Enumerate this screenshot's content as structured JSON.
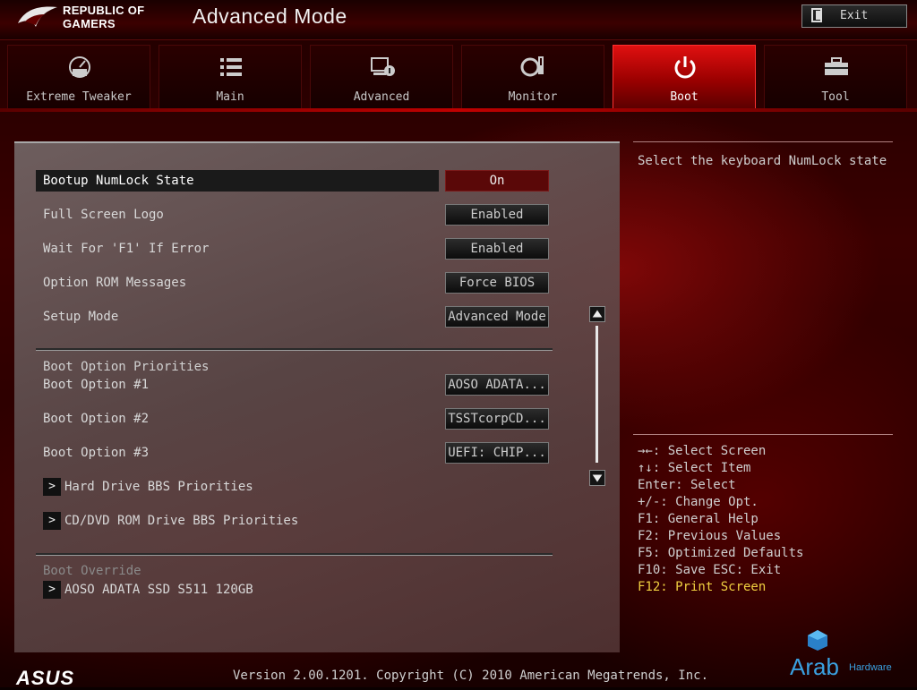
{
  "header": {
    "brand_line1": "REPUBLIC OF",
    "brand_line2": "GAMERS",
    "title": "Advanced Mode",
    "exit_label": "Exit"
  },
  "tabs": [
    {
      "label": "Extreme Tweaker",
      "icon": "speedometer-icon"
    },
    {
      "label": "Main",
      "icon": "list-icon"
    },
    {
      "label": "Advanced",
      "icon": "advanced-settings-icon"
    },
    {
      "label": "Monitor",
      "icon": "monitor-gauge-icon"
    },
    {
      "label": "Boot",
      "icon": "power-icon",
      "active": true
    },
    {
      "label": "Tool",
      "icon": "toolbox-icon"
    }
  ],
  "settings": [
    {
      "label": "Bootup NumLock State",
      "value": "On",
      "selected": true
    },
    {
      "label": "Full Screen Logo",
      "value": "Enabled"
    },
    {
      "label": "Wait For 'F1' If Error",
      "value": "Enabled"
    },
    {
      "label": "Option ROM Messages",
      "value": "Force BIOS"
    },
    {
      "label": "Setup Mode",
      "value": "Advanced Mode"
    }
  ],
  "boot_priorities": {
    "heading": "Boot Option Priorities",
    "options": [
      {
        "label": "Boot Option #1",
        "value": "AOSO ADATA..."
      },
      {
        "label": "Boot Option #2",
        "value": "TSSTcorpCD..."
      },
      {
        "label": "Boot Option #3",
        "value": "UEFI: CHIP..."
      }
    ],
    "submenus": [
      "Hard Drive BBS Priorities",
      "CD/DVD ROM Drive BBS Priorities"
    ]
  },
  "boot_override": {
    "heading": "Boot Override",
    "items": [
      "AOSO ADATA SSD S511 120GB"
    ]
  },
  "help": {
    "description": "Select the keyboard NumLock state",
    "keys": [
      "→←: Select Screen",
      "↑↓: Select Item",
      "Enter: Select",
      "+/-: Change Opt.",
      "F1: General Help",
      "F2: Previous Values",
      "F5: Optimized Defaults",
      "F10: Save  ESC: Exit"
    ],
    "highlight_key": "F12: Print Screen"
  },
  "footer": {
    "asus": "ASUS",
    "version": "Version 2.00.1201. Copyright (C) 2010 American Megatrends, Inc."
  },
  "watermark": {
    "word": "Arab",
    "sub": "Hardware"
  },
  "colors": {
    "accent_red": "#d00000",
    "highlight_yellow": "#f0d040",
    "watermark_blue": "#3aa0e0"
  }
}
